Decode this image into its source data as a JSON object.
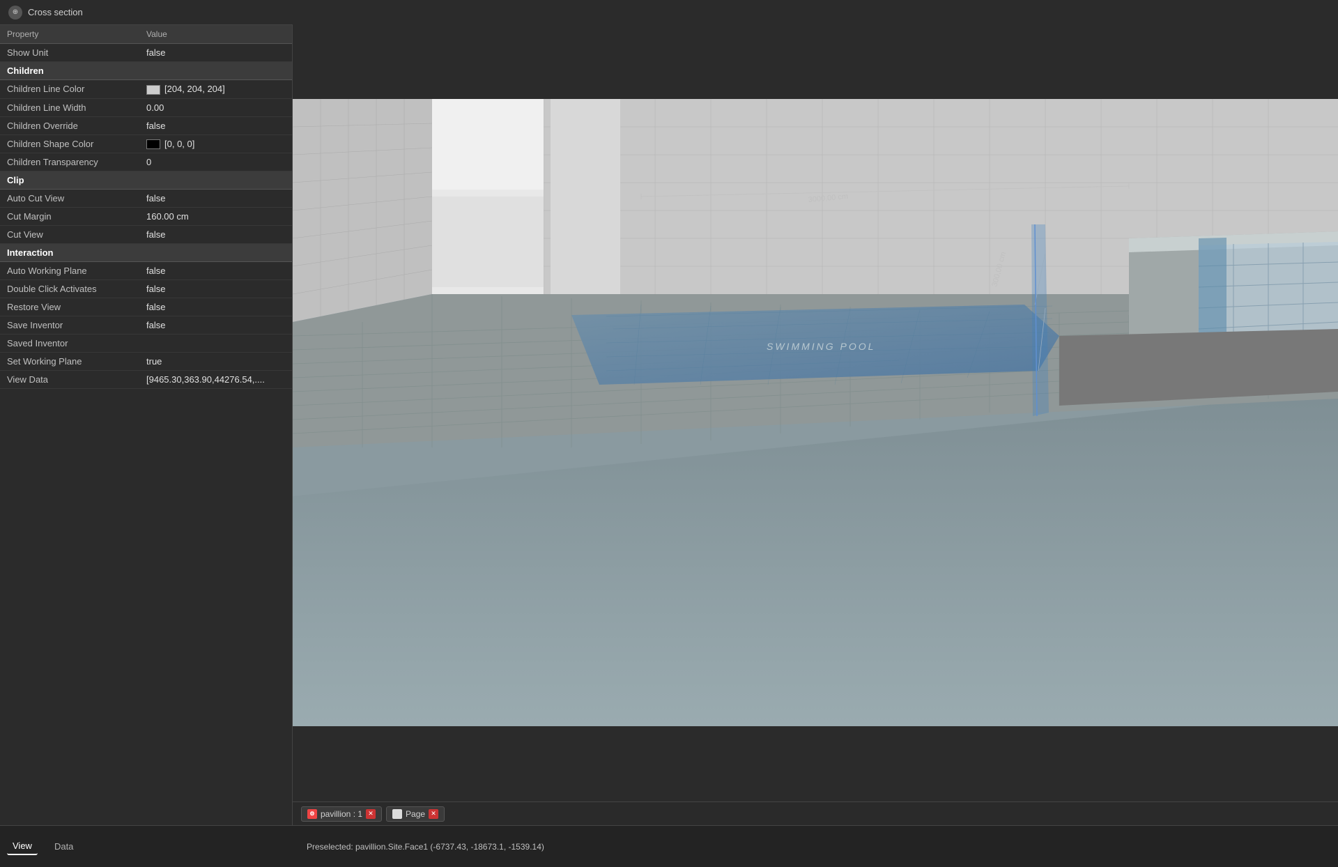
{
  "app": {
    "title": "Cross section",
    "cross_icon": "⊕"
  },
  "properties": {
    "header": {
      "col1": "Property",
      "col2": "Value"
    },
    "rows_above": [
      {
        "property": "Show Unit",
        "value": "false",
        "type": "data"
      }
    ],
    "sections": [
      {
        "name": "Children",
        "rows": [
          {
            "property": "Children Line Color",
            "value": "[204, 204, 204]",
            "type": "color",
            "color": "#cccccc"
          },
          {
            "property": "Children Line Width",
            "value": "0.00",
            "type": "data"
          },
          {
            "property": "Children Override",
            "value": "false",
            "type": "data"
          },
          {
            "property": "Children Shape Color",
            "value": "[0, 0, 0]",
            "type": "color",
            "color": "#000000"
          },
          {
            "property": "Children Transparency",
            "value": "0",
            "type": "data"
          }
        ]
      },
      {
        "name": "Clip",
        "rows": [
          {
            "property": "Auto Cut View",
            "value": "false",
            "type": "data"
          },
          {
            "property": "Cut Margin",
            "value": "160.00 cm",
            "type": "data"
          },
          {
            "property": "Cut View",
            "value": "false",
            "type": "data"
          }
        ]
      },
      {
        "name": "Interaction",
        "rows": [
          {
            "property": "Auto Working Plane",
            "value": "false",
            "type": "data"
          },
          {
            "property": "Double Click Activates",
            "value": "false",
            "type": "data"
          },
          {
            "property": "Restore View",
            "value": "false",
            "type": "data"
          },
          {
            "property": "Save Inventor",
            "value": "false",
            "type": "data"
          },
          {
            "property": "Saved Inventor",
            "value": "",
            "type": "data"
          },
          {
            "property": "Set Working Plane",
            "value": "true",
            "type": "data"
          },
          {
            "property": "View Data",
            "value": "[9465.30,363.90,44276.54,....",
            "type": "data"
          }
        ]
      }
    ]
  },
  "bottom_tabs": [
    {
      "id": "tab-view",
      "label": "View",
      "active": true
    },
    {
      "id": "tab-data",
      "label": "Data",
      "active": false
    }
  ],
  "viewport_tabs": [
    {
      "id": "tab-pavillion",
      "label": "pavillion : 1",
      "icon_color": "red"
    },
    {
      "id": "tab-page",
      "label": "Page",
      "icon_color": "white"
    }
  ],
  "status": {
    "preselected": "Preselected: pavillion.Site.Face1 (-6737.43, -18673.1, -1539.14)"
  },
  "scene": {
    "label_pool": "SWIMMING POOL",
    "label_dim1": "3000,00 cm",
    "label_dim2": "300,00 cm"
  }
}
